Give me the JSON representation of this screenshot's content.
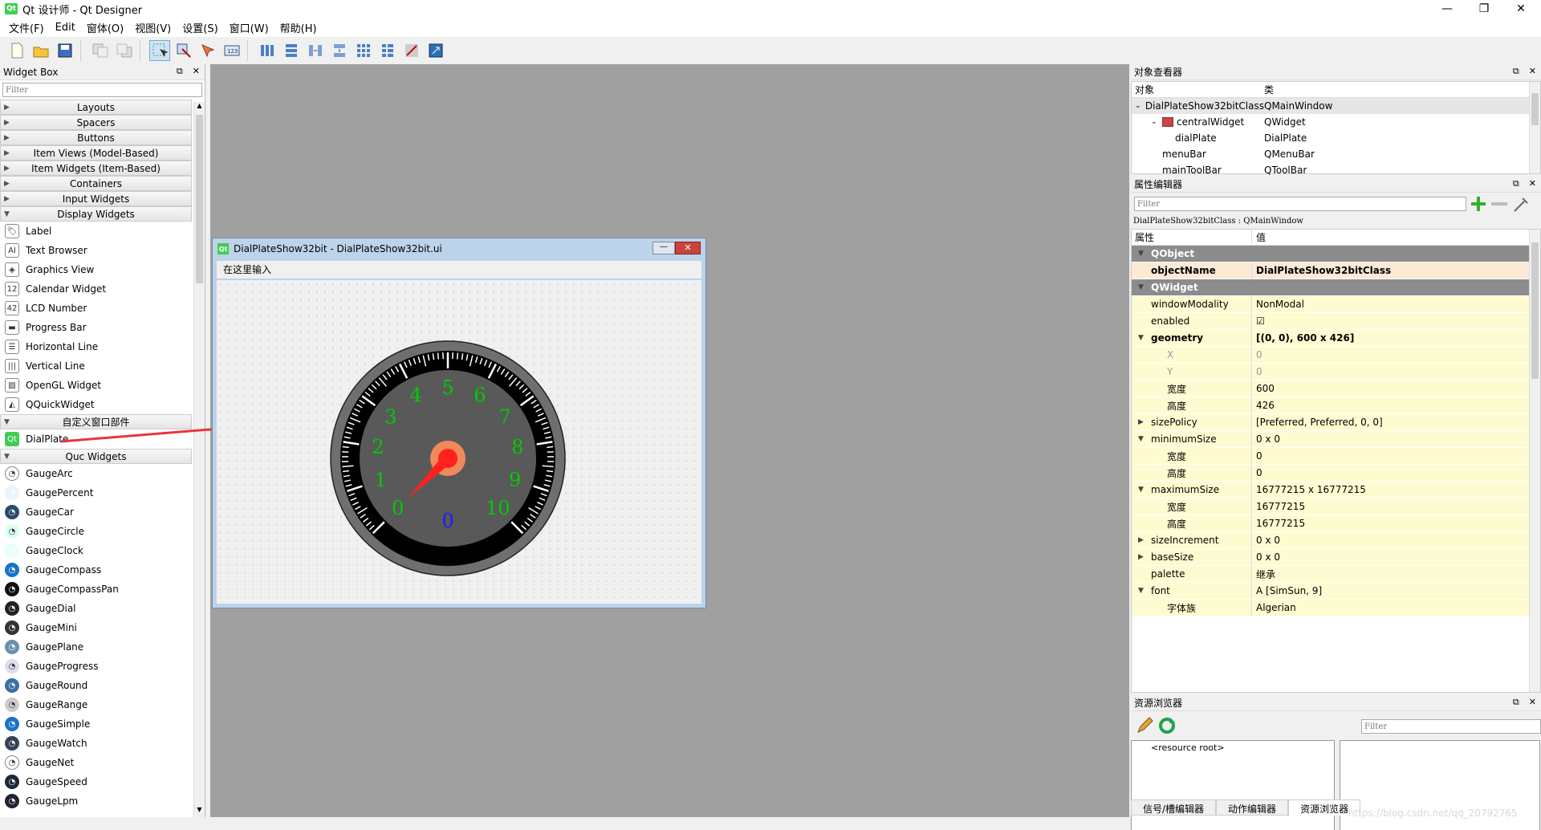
{
  "window": {
    "title": "Qt 设计师 - Qt Designer",
    "minimize": "—",
    "restore": "❐",
    "close": "✕"
  },
  "menu": [
    "文件(F)",
    "Edit",
    "窗体(O)",
    "视图(V)",
    "设置(S)",
    "窗口(W)",
    "帮助(H)"
  ],
  "widget_box": {
    "title": "Widget Box",
    "filter_placeholder": "Filter",
    "categories": [
      "Layouts",
      "Spacers",
      "Buttons",
      "Item Views (Model-Based)",
      "Item Widgets (Item-Based)",
      "Containers",
      "Input Widgets",
      "Display Widgets"
    ],
    "display_widgets": [
      "Label",
      "Text Browser",
      "Graphics View",
      "Calendar Widget",
      "LCD Number",
      "Progress Bar",
      "Horizontal Line",
      "Vertical Line",
      "OpenGL Widget",
      "QQuickWidget"
    ],
    "custom_category": "自定义窗口部件",
    "custom_widgets": [
      "DialPlate"
    ],
    "quc_category": "Quc Widgets",
    "quc_widgets": [
      "GaugeArc",
      "GaugePercent",
      "GaugeCar",
      "GaugeCircle",
      "GaugeClock",
      "GaugeCompass",
      "GaugeCompassPan",
      "GaugeDial",
      "GaugeMini",
      "GaugePlane",
      "GaugeProgress",
      "GaugeRound",
      "GaugeRange",
      "GaugeSimple",
      "GaugeWatch",
      "GaugeNet",
      "GaugeSpeed",
      "GaugeLpm"
    ]
  },
  "form": {
    "title": "DialPlateShow32bit - DialPlateShow32bit.ui",
    "menu_placeholder": "在这里输入",
    "dial_scale_labels": [
      "0",
      "1",
      "2",
      "3",
      "4",
      "5",
      "6",
      "7",
      "8",
      "9",
      "10"
    ],
    "dial_value": "0",
    "scale_color": "#00cc00",
    "value_color": "#1a1aff",
    "pointer_color": "#ff2020"
  },
  "object_inspector": {
    "title": "对象查看器",
    "col_object": "对象",
    "col_class": "类",
    "rows": [
      {
        "object": "DialPlateShow32bitClass",
        "class": "QMainWindow"
      },
      {
        "object": "centralWidget",
        "class": "QWidget"
      },
      {
        "object": "dialPlate",
        "class": "DialPlate"
      },
      {
        "object": "menuBar",
        "class": "QMenuBar"
      },
      {
        "object": "mainToolBar",
        "class": "QToolBar"
      }
    ]
  },
  "property_editor": {
    "title": "属性编辑器",
    "filter_placeholder": "Filter",
    "context": "DialPlateShow32bitClass : QMainWindow",
    "col_property": "属性",
    "col_value": "值",
    "groups": [
      "QObject",
      "QWidget"
    ],
    "rows": [
      {
        "name": "objectName",
        "value": "DialPlateShow32bitClass"
      },
      {
        "name": "windowModality",
        "value": "NonModal"
      },
      {
        "name": "enabled",
        "value": "☑"
      },
      {
        "name": "geometry",
        "value": "[(0, 0), 600 x 426]"
      },
      {
        "name": "X",
        "value": "0"
      },
      {
        "name": "Y",
        "value": "0"
      },
      {
        "name": "宽度",
        "value": "600"
      },
      {
        "name": "高度",
        "value": "426"
      },
      {
        "name": "sizePolicy",
        "value": "[Preferred, Preferred, 0, 0]"
      },
      {
        "name": "minimumSize",
        "value": "0 x 0"
      },
      {
        "name": "宽度",
        "value": "0"
      },
      {
        "name": "高度",
        "value": "0"
      },
      {
        "name": "maximumSize",
        "value": "16777215 x 16777215"
      },
      {
        "name": "宽度",
        "value": "16777215"
      },
      {
        "name": "高度",
        "value": "16777215"
      },
      {
        "name": "sizeIncrement",
        "value": "0 x 0"
      },
      {
        "name": "baseSize",
        "value": "0 x 0"
      },
      {
        "name": "palette",
        "value": "继承"
      },
      {
        "name": "font",
        "value": "A  [SimSun, 9]"
      },
      {
        "name": "字体族",
        "value": "Algerian"
      }
    ]
  },
  "resource_browser": {
    "title": "资源浏览器",
    "filter_placeholder": "Filter",
    "root": "<resource root>",
    "tabs": [
      "信号/槽编辑器",
      "动作编辑器",
      "资源浏览器"
    ]
  },
  "watermark": "https://blog.csdn.net/qq_20792765"
}
